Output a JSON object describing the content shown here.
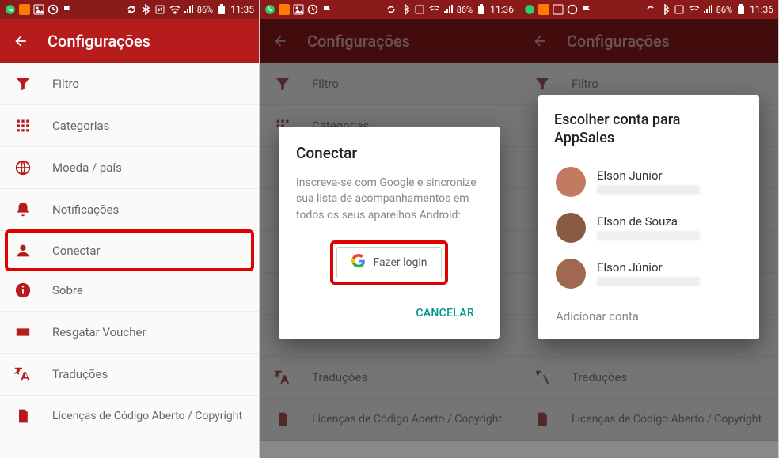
{
  "status": {
    "battery": "86%",
    "time1": "11:35",
    "time2": "11:36",
    "time3": "11:36"
  },
  "appbar": {
    "title": "Configurações"
  },
  "settings": [
    {
      "key": "filtro",
      "label": "Filtro",
      "icon": "funnel-icon"
    },
    {
      "key": "categorias",
      "label": "Categorias",
      "icon": "grid-icon"
    },
    {
      "key": "moeda",
      "label": "Moeda / país",
      "icon": "globe-icon"
    },
    {
      "key": "notificacoes",
      "label": "Notificações",
      "icon": "bell-icon"
    },
    {
      "key": "conectar",
      "label": "Conectar",
      "icon": "person-icon"
    },
    {
      "key": "sobre",
      "label": "Sobre",
      "icon": "info-icon"
    },
    {
      "key": "resgatar",
      "label": "Resgatar Voucher",
      "icon": "ticket-icon"
    },
    {
      "key": "traducoes",
      "label": "Traduções",
      "icon": "translate-icon"
    },
    {
      "key": "licencas",
      "label": "Licenças de Código Aberto / Copyright",
      "icon": "document-icon"
    }
  ],
  "dialog_connect": {
    "title": "Conectar",
    "body": "Inscreva-se com Google e sincronize sua lista de acompanhamentos em todos os seus aparelhos Android:",
    "login_label": "Fazer login",
    "cancel_label": "CANCELAR"
  },
  "dialog_accounts": {
    "title": "Escolher conta para AppSales",
    "add_label": "Adicionar conta",
    "accounts": [
      {
        "name": "Elson Junior"
      },
      {
        "name": "Elson de Souza"
      },
      {
        "name": "Elson Júnior"
      }
    ]
  }
}
